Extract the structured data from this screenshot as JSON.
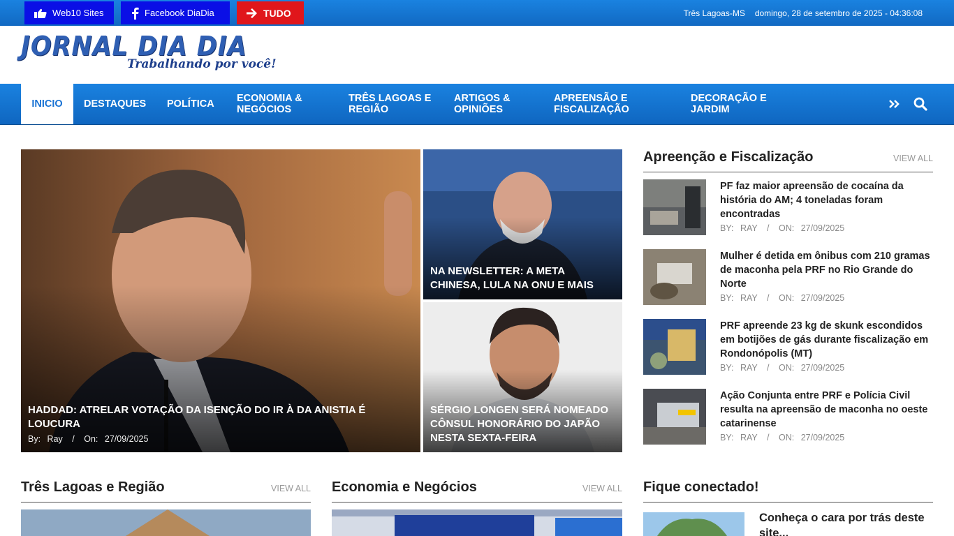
{
  "topbar": {
    "web10_label": "Web10 Sites",
    "facebook_label": "Facebook DiaDia",
    "tudo_label": "TUDO",
    "location": "Três Lagoas-MS",
    "datetime": "domingo, 28 de setembro de 2025 - 04:36:08"
  },
  "logo": {
    "main": "JORNAL DIA DIA",
    "tagline": "Trabalhando por você!"
  },
  "nav": {
    "items": [
      {
        "label": "INICIO"
      },
      {
        "label": "DESTAQUES"
      },
      {
        "label": "POLÍTICA"
      },
      {
        "label": "ECONOMIA & NEGÓCIOS"
      },
      {
        "label": "TRÊS LAGOAS E REGIÃO"
      },
      {
        "label": "ARTIGOS & OPINIÕES"
      },
      {
        "label": "APREENSÃO E FISCALIZAÇÃO"
      },
      {
        "label": "DECORAÇÃO E JARDIM"
      }
    ]
  },
  "featured": {
    "main": {
      "title": "HADDAD: ATRELAR VOTAÇÃO DA ISENÇÃO DO IR À DA ANISTIA É LOUCURA",
      "by_label": "By:",
      "author": "Ray",
      "on_label": "On:",
      "date": "27/09/2025"
    },
    "top_right": {
      "title": "NA NEWSLETTER: A META CHINESA, LULA NA ONU E MAIS"
    },
    "bottom_right": {
      "title": "SÉRGIO LONGEN SERÁ NOMEADO CÔNSUL HONORÁRIO DO JAPÃO NESTA SEXTA-FEIRA"
    }
  },
  "sidebar": {
    "title": "Apreenção e Fiscalização",
    "view_all": "VIEW ALL",
    "items": [
      {
        "title": "PF faz maior apreensão de cocaína da história do AM; 4 toneladas foram encontradas",
        "by_label": "BY:",
        "author": "RAY",
        "on_label": "ON:",
        "date": "27/09/2025"
      },
      {
        "title": "Mulher é detida em ônibus com 210 gramas de maconha pela PRF no Rio Grande do Norte",
        "by_label": "BY:",
        "author": "RAY",
        "on_label": "ON:",
        "date": "27/09/2025"
      },
      {
        "title": "PRF apreende 23 kg de skunk escondidos em botijões de gás durante fiscalização em Rondonópolis (MT)",
        "by_label": "BY:",
        "author": "RAY",
        "on_label": "ON:",
        "date": "27/09/2025"
      },
      {
        "title": "Ação Conjunta entre PRF e Polícia Civil resulta na apreensão de maconha no oeste catarinense",
        "by_label": "BY:",
        "author": "RAY",
        "on_label": "ON:",
        "date": "27/09/2025"
      }
    ]
  },
  "sections": {
    "tres_lagoas": {
      "title": "Três Lagoas e Região",
      "view_all": "VIEW ALL"
    },
    "economia": {
      "title": "Economia e Negócios",
      "view_all": "VIEW ALL"
    },
    "fique": {
      "title": "Fique conectado!",
      "article_title": "Conheça o cara por trás deste site..."
    }
  },
  "icons": {
    "thumbs_up": "thumbs-up-icon",
    "facebook": "facebook-icon",
    "arrow": "arrow-right-icon",
    "more": "double-chevron-right-icon",
    "search": "search-icon"
  },
  "colors": {
    "brand_blue": "#1a82e0",
    "button_blue": "#0a0fe6",
    "tudo_red": "#e0161b"
  }
}
